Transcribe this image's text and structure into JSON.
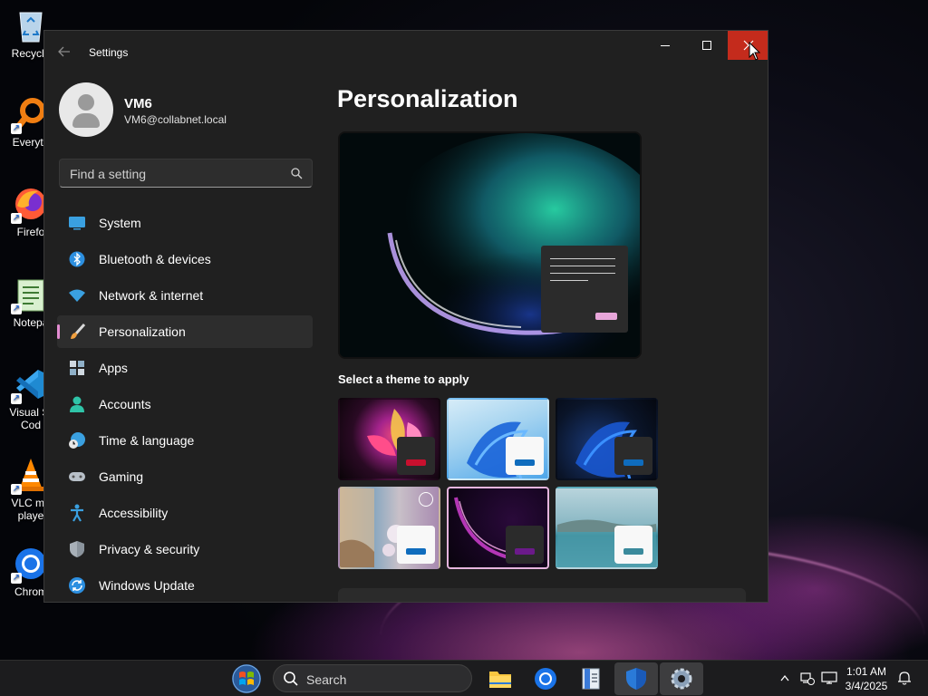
{
  "desktop": {
    "icons": [
      {
        "label": "Recycle",
        "icon": "recycle-bin-icon"
      },
      {
        "label": "Everyth",
        "icon": "everything-search-icon"
      },
      {
        "label": "Firefo",
        "icon": "firefox-icon"
      },
      {
        "label": "Notepa",
        "icon": "notepad-icon"
      },
      {
        "label": "Visual St\nCod",
        "icon": "vscode-icon"
      },
      {
        "label": "VLC me\nplaye",
        "icon": "vlc-icon"
      },
      {
        "label": "Chrom",
        "icon": "chrome-icon"
      }
    ]
  },
  "window": {
    "title": "Settings",
    "controls": [
      "minimize-icon",
      "maximize-icon",
      "close-icon"
    ],
    "close_color": "#c42b1c"
  },
  "user": {
    "name": "VM6",
    "email": "VM6@collabnet.local"
  },
  "search": {
    "placeholder": "Find a setting"
  },
  "nav": {
    "items": [
      {
        "label": "System",
        "icon": "system-icon",
        "selected": false
      },
      {
        "label": "Bluetooth & devices",
        "icon": "bluetooth-icon",
        "selected": false
      },
      {
        "label": "Network & internet",
        "icon": "wifi-icon",
        "selected": false
      },
      {
        "label": "Personalization",
        "icon": "paintbrush-icon",
        "selected": true
      },
      {
        "label": "Apps",
        "icon": "apps-icon",
        "selected": false
      },
      {
        "label": "Accounts",
        "icon": "accounts-icon",
        "selected": false
      },
      {
        "label": "Time & language",
        "icon": "globe-clock-icon",
        "selected": false
      },
      {
        "label": "Gaming",
        "icon": "gamepad-icon",
        "selected": false
      },
      {
        "label": "Accessibility",
        "icon": "accessibility-icon",
        "selected": false
      },
      {
        "label": "Privacy & security",
        "icon": "shield-icon",
        "selected": false
      },
      {
        "label": "Windows Update",
        "icon": "windows-update-icon",
        "selected": false
      }
    ],
    "accent": "#e38cd1"
  },
  "main": {
    "title": "Personalization",
    "themes_heading": "Select a theme to apply",
    "themes": [
      {
        "name": "theme-glow-flower",
        "accent": "#c8102e",
        "selected": false
      },
      {
        "name": "theme-windows-light",
        "accent": "#0f6cbd",
        "selected": false
      },
      {
        "name": "theme-windows-dark",
        "accent": "#0f6cbd",
        "selected": false
      },
      {
        "name": "theme-spotlight",
        "accent": "#0f6cbd",
        "selected": false
      },
      {
        "name": "theme-glow-purple",
        "accent": "#6b1a8a",
        "selected": true
      },
      {
        "name": "theme-captured-motion",
        "accent": "#3a8a9c",
        "selected": false
      }
    ]
  },
  "taskbar": {
    "search_label": "Search",
    "apps": [
      "start-icon",
      "file-explorer-icon",
      "chrome-taskbar-icon",
      "notepad-taskbar-icon",
      "defender-icon",
      "settings-taskbar-icon"
    ],
    "tray": [
      "chevron-up-icon",
      "network-icon",
      "display-icon"
    ],
    "time": "1:01 AM",
    "date": "3/4/2025",
    "notification_icon": "bell-icon"
  }
}
